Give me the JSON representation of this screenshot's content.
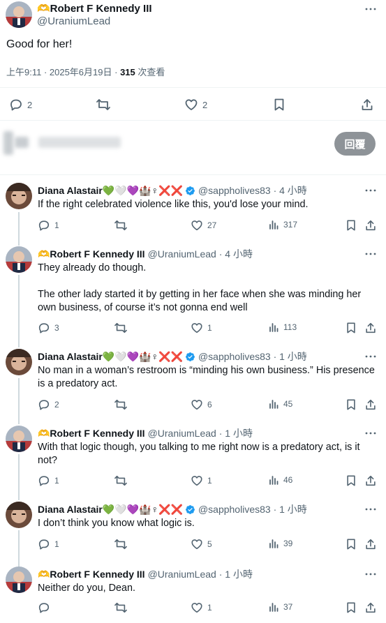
{
  "main_tweet": {
    "author_name": "🫶Robert F Kennedy III",
    "handle": "@UraniumLead",
    "text": "Good for her!",
    "time": "上午9:11 · 2025年6月19日 · ",
    "views": "315",
    "views_label": " 次查看",
    "replies": "2",
    "likes": "2"
  },
  "composer": {
    "reply_button": "回覆"
  },
  "replies": [
    {
      "name": "Diana Alastair💚🤍💜🏰♀❌❌",
      "handle": "@sappholives83 · 4 小時",
      "text": [
        "If the right celebrated violence like this, you'd lose your mind."
      ],
      "replies": "1",
      "likes": "27",
      "views": "317",
      "verified": true
    },
    {
      "name": "🫶Robert F Kennedy III",
      "handle": "@UraniumLead · 4 小時",
      "text": [
        "They already do though.",
        "The other lady started it by getting in her face when she was minding her own business, of course it’s not gonna end well"
      ],
      "replies": "3",
      "likes": "1",
      "views": "113",
      "verified": false
    },
    {
      "name": "Diana Alastair💚🤍💜🏰♀❌❌",
      "handle": "@sappholives83 · 1 小時",
      "text": [
        "No man in a woman’s restroom is “minding his own business.” His presence is a predatory act."
      ],
      "replies": "2",
      "likes": "6",
      "views": "45",
      "verified": true
    },
    {
      "name": "🫶Robert F Kennedy III",
      "handle": "@UraniumLead · 1 小時",
      "text": [
        "With that logic though, you talking to me right now is a predatory act, is it not?"
      ],
      "replies": "1",
      "likes": "1",
      "views": "46",
      "verified": false
    },
    {
      "name": "Diana Alastair💚🤍💜🏰♀❌❌",
      "handle": "@sappholives83 · 1 小時",
      "text": [
        "I don’t think you know what logic is."
      ],
      "replies": "1",
      "likes": "5",
      "views": "39",
      "verified": true
    },
    {
      "name": "🫶Robert F Kennedy III",
      "handle": "@UraniumLead · 1 小時",
      "text": [
        "Neither do you, Dean."
      ],
      "replies": "",
      "likes": "1",
      "views": "37",
      "verified": false
    }
  ],
  "colors": {
    "text": "#0f1419",
    "secondary": "#536471",
    "verified": "#1d9bf0",
    "button": "#8e9398"
  }
}
